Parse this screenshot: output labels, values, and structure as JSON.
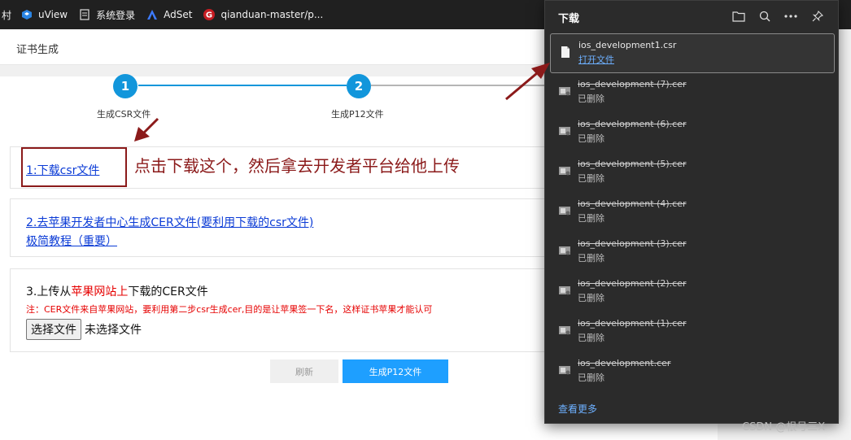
{
  "bookmarks": [
    {
      "label": "村",
      "icon": "cut-icon"
    },
    {
      "label": "uView",
      "icon": "uview-icon"
    },
    {
      "label": "系统登录",
      "icon": "page-icon"
    },
    {
      "label": "AdSet",
      "icon": "adset-icon"
    },
    {
      "label": "qianduan-master/p...",
      "icon": "gitee-icon"
    }
  ],
  "page": {
    "title": "证书生成",
    "steps": [
      {
        "number": "1",
        "label": "生成CSR文件"
      },
      {
        "number": "2",
        "label": "生成P12文件"
      }
    ],
    "panel1": {
      "link": "1:下载csr文件"
    },
    "annotation": "点击下载这个，然后拿去开发者平台给他上传",
    "panel2": {
      "link1": "2.去苹果开发者中心生成CER文件(要利用下载的csr文件)",
      "link2": "极简教程（重要）"
    },
    "panel3": {
      "title_prefix": "3.上传从",
      "title_red": "苹果网站上",
      "title_suffix": "下载的CER文件",
      "note": "注：CER文件来自苹果网站，要利用第二步csr生成cer,目的是让苹果签一下名，这样证书苹果才能认可",
      "file_button": "选择文件",
      "file_status": "未选择文件"
    },
    "buttons": {
      "refresh": "刷新",
      "generate": "生成P12文件"
    }
  },
  "downloads": {
    "title": "下载",
    "items": [
      {
        "name": "ios_development1.csr",
        "status": "打开文件",
        "deleted": false
      },
      {
        "name": "ios_development (7).cer",
        "status": "已删除",
        "deleted": true
      },
      {
        "name": "ios_development (6).cer",
        "status": "已删除",
        "deleted": true
      },
      {
        "name": "ios_development (5).cer",
        "status": "已删除",
        "deleted": true
      },
      {
        "name": "ios_development (4).cer",
        "status": "已删除",
        "deleted": true
      },
      {
        "name": "ios_development (3).cer",
        "status": "已删除",
        "deleted": true
      },
      {
        "name": "ios_development (2).cer",
        "status": "已删除",
        "deleted": true
      },
      {
        "name": "ios_development (1).cer",
        "status": "已删除",
        "deleted": true
      },
      {
        "name": "ios_development.cer",
        "status": "已删除",
        "deleted": true
      }
    ],
    "more": "查看更多"
  },
  "watermark": "CSDN @根号三X",
  "colors": {
    "accent": "#1296db",
    "annotation": "#8b1a1a",
    "link": "#0b3bd6",
    "note_red": "#e60000"
  }
}
